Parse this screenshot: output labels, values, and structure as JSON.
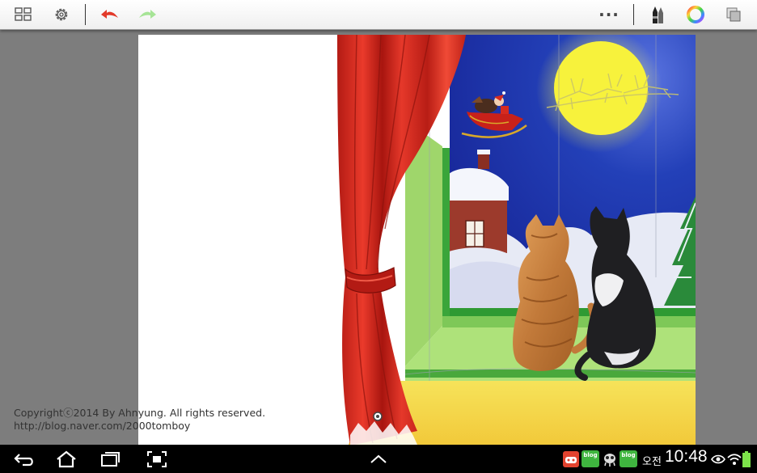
{
  "toolbar": {
    "left_icons": [
      "grid-view-icon",
      "settings-gear-icon",
      "undo-arrow-icon",
      "redo-arrow-icon"
    ],
    "right_icons": [
      "more-options-icon",
      "brush-pens-icon",
      "color-wheel-icon",
      "layers-icon"
    ],
    "more_label": "···"
  },
  "canvas": {
    "copyright_line1": "Copyrightⓒ2014 By Ahnyung. All rights reserved.",
    "copyright_line2": "http://blog.naver.com/2000tomboy"
  },
  "system_bar": {
    "nav_icons": [
      "back-icon",
      "home-icon",
      "recent-apps-icon",
      "screenshot-icon"
    ],
    "expand_icon": "chevron-up-icon",
    "notifications": [
      "game-icon",
      "blog-icon",
      "alien-icon",
      "blog-icon"
    ],
    "blog_label": "blog",
    "ampm": "오전",
    "time": "10:48",
    "status_icons": [
      "visibility-icon",
      "wifi-icon",
      "battery-icon"
    ]
  },
  "colors": {
    "toolbar_bg": "#f4f4f4",
    "workspace_bg": "#7d7d7d",
    "undo_red": "#e23a2a",
    "redo_green": "#9be08a",
    "system_bar_bg": "#000000",
    "sky_blue": "#1f3fb5",
    "moon_yellow": "#f6f24a",
    "curtain_red": "#d4281e"
  }
}
